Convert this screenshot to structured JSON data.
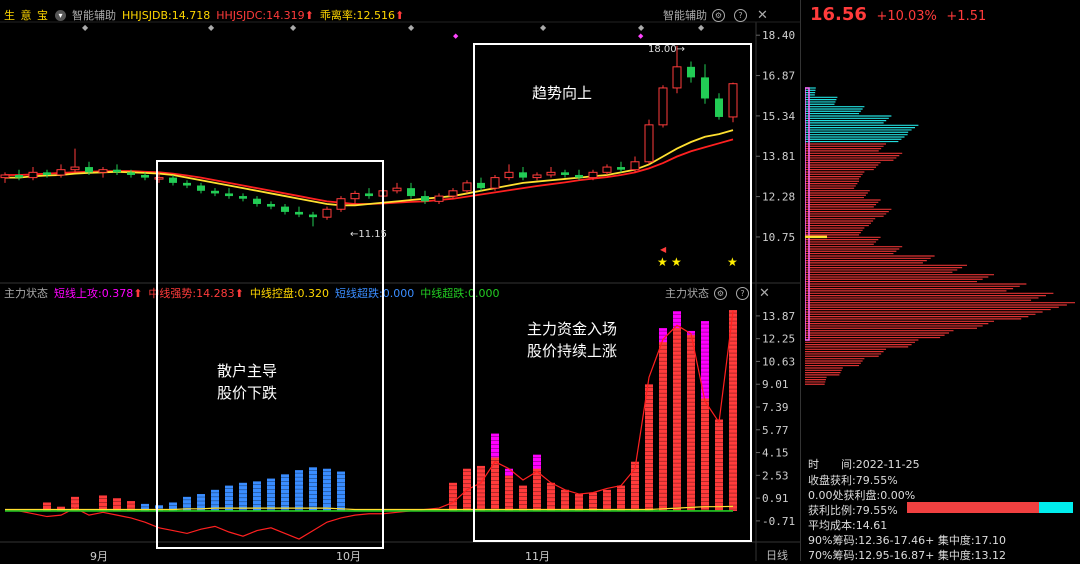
{
  "header": {
    "app": "生 意 宝",
    "indicator_name": "智能辅助",
    "items": [
      {
        "label": "HHJSJDB:14.718",
        "color": "#ffd700"
      },
      {
        "label": "HHJSJDC:14.319",
        "color": "#ff3b3b"
      },
      {
        "label": "乖离率:12.516",
        "color": "#ffd700"
      }
    ],
    "right_label": "智能辅助"
  },
  "sub_header": {
    "name": "主力状态",
    "items": [
      {
        "label": "短线上攻:0.378",
        "color": "#ff00ff"
      },
      {
        "label": "中线强势:14.283",
        "color": "#ff3b3b"
      },
      {
        "label": "中线控盘:0.320",
        "color": "#ffd700"
      },
      {
        "label": "短线超跌:0.000",
        "color": "#3a8dff"
      },
      {
        "label": "中线超跌:0.000",
        "color": "#22cc22"
      }
    ],
    "right_label": "主力状态"
  },
  "quote": {
    "price": "16.56",
    "pct": "+10.03%",
    "change": "+1.51"
  },
  "annotations": {
    "box1_line1": "散户主导",
    "box1_line2": "股价下跌",
    "box2_line1": "趋势向上",
    "box3_line1": "主力资金入场",
    "box3_line2": "股价持续上涨"
  },
  "price_marks": {
    "high": "18.00",
    "low": "11.15"
  },
  "x_axis": {
    "labels": [
      "9月",
      "10月",
      "11月"
    ],
    "period": "日线"
  },
  "stats": {
    "date_label": "时　　间:2022-11-25",
    "profit_close": "收盘获利:79.55%",
    "profit_zero": "0.00处获利盘:0.00%",
    "profit_ratio": "获利比例:79.55%",
    "avg_cost": "平均成本:14.61",
    "chip90": "90%筹码:12.36-17.46+ 集中度:17.10",
    "chip70": "70%筹码:12.95-16.87+ 集中度:13.12",
    "profit_ratio_value": 0.7955
  },
  "chart_data": [
    {
      "type": "candlestick",
      "title": "",
      "y_ticks": [
        18.4,
        16.87,
        15.34,
        13.81,
        12.28,
        10.75
      ],
      "ylim": [
        9.8,
        18.9
      ],
      "candles": [
        [
          13.0,
          13.2,
          12.8,
          13.1
        ],
        [
          13.1,
          13.3,
          12.9,
          13.0
        ],
        [
          13.0,
          13.4,
          12.9,
          13.2
        ],
        [
          13.2,
          13.3,
          13.0,
          13.1
        ],
        [
          13.1,
          13.5,
          13.0,
          13.3
        ],
        [
          13.3,
          14.1,
          13.2,
          13.4
        ],
        [
          13.4,
          13.6,
          13.1,
          13.2
        ],
        [
          13.2,
          13.4,
          13.0,
          13.3
        ],
        [
          13.3,
          13.5,
          13.1,
          13.2
        ],
        [
          13.2,
          13.3,
          13.0,
          13.1
        ],
        [
          13.1,
          13.2,
          12.9,
          13.0
        ],
        [
          13.0,
          13.2,
          12.8,
          13.0
        ],
        [
          13.0,
          13.1,
          12.7,
          12.8
        ],
        [
          12.8,
          12.9,
          12.6,
          12.7
        ],
        [
          12.7,
          12.8,
          12.4,
          12.5
        ],
        [
          12.5,
          12.6,
          12.3,
          12.4
        ],
        [
          12.4,
          12.6,
          12.2,
          12.3
        ],
        [
          12.3,
          12.4,
          12.1,
          12.2
        ],
        [
          12.2,
          12.3,
          11.9,
          12.0
        ],
        [
          12.0,
          12.1,
          11.8,
          11.9
        ],
        [
          11.9,
          12.0,
          11.6,
          11.7
        ],
        [
          11.7,
          11.9,
          11.5,
          11.6
        ],
        [
          11.6,
          11.7,
          11.15,
          11.5
        ],
        [
          11.5,
          11.9,
          11.4,
          11.8
        ],
        [
          11.8,
          12.3,
          11.7,
          12.2
        ],
        [
          12.2,
          12.5,
          12.0,
          12.4
        ],
        [
          12.4,
          12.6,
          12.2,
          12.3
        ],
        [
          12.3,
          12.6,
          12.1,
          12.5
        ],
        [
          12.5,
          12.8,
          12.4,
          12.6
        ],
        [
          12.6,
          12.8,
          12.2,
          12.3
        ],
        [
          12.3,
          12.5,
          12.0,
          12.1
        ],
        [
          12.1,
          12.4,
          12.0,
          12.3
        ],
        [
          12.3,
          12.6,
          12.2,
          12.5
        ],
        [
          12.5,
          12.9,
          12.4,
          12.8
        ],
        [
          12.8,
          13.0,
          12.5,
          12.6
        ],
        [
          12.6,
          13.1,
          12.5,
          13.0
        ],
        [
          13.0,
          13.5,
          12.9,
          13.2
        ],
        [
          13.2,
          13.4,
          12.9,
          13.0
        ],
        [
          13.0,
          13.2,
          12.9,
          13.1
        ],
        [
          13.1,
          13.4,
          13.0,
          13.2
        ],
        [
          13.2,
          13.3,
          13.0,
          13.1
        ],
        [
          13.1,
          13.3,
          12.9,
          13.0
        ],
        [
          13.0,
          13.3,
          12.9,
          13.2
        ],
        [
          13.2,
          13.5,
          13.1,
          13.4
        ],
        [
          13.4,
          13.6,
          13.2,
          13.3
        ],
        [
          13.3,
          13.8,
          13.2,
          13.6
        ],
        [
          13.6,
          15.2,
          13.5,
          15.0
        ],
        [
          15.0,
          16.5,
          14.9,
          16.4
        ],
        [
          16.4,
          18.0,
          16.2,
          17.2
        ],
        [
          17.2,
          17.4,
          16.6,
          16.8
        ],
        [
          16.8,
          17.3,
          15.8,
          16.0
        ],
        [
          16.0,
          16.2,
          15.2,
          15.3
        ],
        [
          15.3,
          16.6,
          15.1,
          16.56
        ]
      ],
      "ma_yellow": [
        13.0,
        13.0,
        13.05,
        13.08,
        13.1,
        13.15,
        13.18,
        13.2,
        13.22,
        13.2,
        13.18,
        13.15,
        13.1,
        13.0,
        12.9,
        12.8,
        12.7,
        12.6,
        12.5,
        12.4,
        12.3,
        12.2,
        12.1,
        12.0,
        11.95,
        11.95,
        12.0,
        12.05,
        12.1,
        12.15,
        12.2,
        12.25,
        12.3,
        12.4,
        12.5,
        12.6,
        12.7,
        12.8,
        12.85,
        12.9,
        12.95,
        13.0,
        13.05,
        13.1,
        13.2,
        13.3,
        13.5,
        13.8,
        14.1,
        14.35,
        14.55,
        14.65,
        14.8
      ],
      "ma_red": [
        13.1,
        13.1,
        13.12,
        13.15,
        13.18,
        13.2,
        13.22,
        13.24,
        13.25,
        13.25,
        13.22,
        13.2,
        13.15,
        13.08,
        13.0,
        12.9,
        12.8,
        12.7,
        12.6,
        12.5,
        12.4,
        12.3,
        12.2,
        12.1,
        12.05,
        12.0,
        12.0,
        12.02,
        12.05,
        12.08,
        12.1,
        12.15,
        12.2,
        12.28,
        12.36,
        12.44,
        12.52,
        12.6,
        12.68,
        12.75,
        12.82,
        12.9,
        12.96,
        13.02,
        13.1,
        13.2,
        13.35,
        13.55,
        13.8,
        14.0,
        14.15,
        14.3,
        14.45
      ],
      "stars": [
        47,
        48,
        52
      ]
    },
    {
      "type": "bar",
      "title": "",
      "y_ticks": [
        13.87,
        12.25,
        10.63,
        9.01,
        7.39,
        5.77,
        4.15,
        2.53,
        0.91,
        -0.71
      ],
      "ylim": [
        -1.5,
        15.0
      ],
      "series": [
        {
          "name": "短线上攻",
          "color": "#ff00ff",
          "values": [
            0,
            0,
            0,
            0,
            0,
            0,
            0,
            0,
            0,
            0,
            0,
            0,
            0,
            0,
            0,
            0,
            0,
            0,
            0,
            0,
            0,
            0,
            0,
            0,
            0,
            0,
            0,
            0,
            0,
            0,
            0,
            0,
            0,
            0,
            0,
            5.5,
            3.0,
            0,
            4.0,
            0,
            0,
            0,
            0,
            0,
            0,
            0,
            7.0,
            13.0,
            14.2,
            12.8,
            13.5,
            0.4,
            0.38
          ]
        },
        {
          "name": "中线强势",
          "color": "#ff3b3b",
          "values": [
            0,
            0,
            0,
            0.6,
            0.3,
            1.0,
            0,
            1.1,
            0.9,
            0.7,
            0,
            0,
            0,
            0,
            0,
            0,
            0,
            0,
            0,
            0,
            0,
            0,
            0,
            0,
            0,
            0,
            0,
            0,
            0,
            0,
            0,
            0,
            2.0,
            3.0,
            3.2,
            3.8,
            2.5,
            1.8,
            3.0,
            2.0,
            1.5,
            1.2,
            1.3,
            1.5,
            1.8,
            3.5,
            9.0,
            12.0,
            13.0,
            12.5,
            8.0,
            6.5,
            14.283
          ]
        },
        {
          "name": "短线超跌",
          "color": "#3a8dff",
          "values": [
            0,
            0,
            0,
            0,
            0,
            0,
            0,
            0,
            0,
            0,
            0.5,
            0.4,
            0.6,
            1.0,
            1.2,
            1.5,
            1.8,
            2.0,
            2.1,
            2.3,
            2.6,
            2.9,
            3.1,
            3.0,
            2.8,
            0,
            0,
            0,
            0,
            0,
            0,
            0,
            0,
            0,
            0,
            0,
            0,
            0,
            0,
            0,
            0,
            0,
            0,
            0,
            0,
            0,
            0,
            0,
            0,
            0,
            0,
            0,
            0
          ]
        }
      ],
      "line_red": [
        0,
        0,
        -0.2,
        -0.4,
        -0.3,
        0.2,
        -0.3,
        -0.1,
        -0.3,
        -0.5,
        -0.8,
        -1.2,
        -1.4,
        -1.6,
        -1.3,
        -1.1,
        -1.5,
        -1.8,
        -1.4,
        -1.2,
        -1.6,
        -2.0,
        -1.4,
        -0.8,
        -0.5,
        -0.3,
        -0.2,
        -0.2,
        -0.1,
        0,
        0.1,
        0.2,
        0.6,
        1.5,
        2.0,
        3.5,
        3.0,
        2.2,
        2.8,
        2.0,
        1.5,
        1.2,
        1.3,
        1.6,
        1.8,
        3.0,
        9.5,
        12.2,
        13.2,
        12.6,
        7.8,
        6.3,
        14.2
      ],
      "line_yellow": [
        0.1,
        0.1,
        0.1,
        0.1,
        0.1,
        0.1,
        0.1,
        0.1,
        0.1,
        0.1,
        0.1,
        0.1,
        0.1,
        0.15,
        0.15,
        0.2,
        0.2,
        0.2,
        0.2,
        0.2,
        0.2,
        0.2,
        0.2,
        0.2,
        0.15,
        0.1,
        0.1,
        0.1,
        0.1,
        0.1,
        0.1,
        0.1,
        0.1,
        0.1,
        0.1,
        0.1,
        0.1,
        0.1,
        0.1,
        0.1,
        0.1,
        0.1,
        0.1,
        0.1,
        0.1,
        0.1,
        0.1,
        0.15,
        0.2,
        0.25,
        0.3,
        0.3,
        0.32
      ],
      "line_green": [
        0,
        0,
        0,
        0,
        0,
        0,
        0,
        0,
        0,
        0,
        0,
        0,
        0,
        0,
        0,
        0,
        0,
        0,
        0,
        0,
        0,
        0,
        0,
        0,
        0,
        0,
        0,
        0,
        0,
        0,
        0,
        0,
        0,
        0,
        0,
        0,
        0,
        0,
        0,
        0,
        0,
        0,
        0,
        0,
        0,
        0,
        0,
        0,
        0,
        0,
        0,
        0,
        0
      ]
    },
    {
      "type": "bar",
      "title": "",
      "orientation": "horizontal",
      "ylim": [
        10.0,
        19.0
      ],
      "rows": [
        {
          "y": 17.8,
          "v": 0.04,
          "c": "#2dd"
        },
        {
          "y": 17.6,
          "v": 0.12,
          "c": "#2dd"
        },
        {
          "y": 17.4,
          "v": 0.22,
          "c": "#2dd"
        },
        {
          "y": 17.2,
          "v": 0.32,
          "c": "#2dd"
        },
        {
          "y": 17.0,
          "v": 0.42,
          "c": "#2dd"
        },
        {
          "y": 16.8,
          "v": 0.38,
          "c": "#2dd"
        },
        {
          "y": 16.6,
          "v": 0.3,
          "c": "#d33"
        },
        {
          "y": 16.4,
          "v": 0.36,
          "c": "#d33"
        },
        {
          "y": 16.2,
          "v": 0.28,
          "c": "#d33"
        },
        {
          "y": 16.0,
          "v": 0.22,
          "c": "#d33"
        },
        {
          "y": 15.8,
          "v": 0.2,
          "c": "#d33"
        },
        {
          "y": 15.6,
          "v": 0.24,
          "c": "#d33"
        },
        {
          "y": 15.4,
          "v": 0.28,
          "c": "#d33"
        },
        {
          "y": 15.2,
          "v": 0.32,
          "c": "#d33"
        },
        {
          "y": 15.0,
          "v": 0.26,
          "c": "#d33"
        },
        {
          "y": 14.8,
          "v": 0.22,
          "c": "#d33"
        },
        {
          "y": 14.6,
          "v": 0.28,
          "c": "#d33"
        },
        {
          "y": 14.4,
          "v": 0.36,
          "c": "#d33"
        },
        {
          "y": 14.2,
          "v": 0.48,
          "c": "#d33"
        },
        {
          "y": 14.0,
          "v": 0.6,
          "c": "#d33"
        },
        {
          "y": 13.8,
          "v": 0.7,
          "c": "#d33"
        },
        {
          "y": 13.6,
          "v": 0.82,
          "c": "#d33"
        },
        {
          "y": 13.4,
          "v": 0.92,
          "c": "#d33"
        },
        {
          "y": 13.2,
          "v": 1.0,
          "c": "#d33"
        },
        {
          "y": 13.0,
          "v": 0.88,
          "c": "#d33"
        },
        {
          "y": 12.8,
          "v": 0.7,
          "c": "#d33"
        },
        {
          "y": 12.6,
          "v": 0.55,
          "c": "#d33"
        },
        {
          "y": 12.4,
          "v": 0.42,
          "c": "#d33"
        },
        {
          "y": 12.2,
          "v": 0.3,
          "c": "#d33"
        },
        {
          "y": 12.0,
          "v": 0.22,
          "c": "#d33"
        },
        {
          "y": 11.8,
          "v": 0.14,
          "c": "#d33"
        },
        {
          "y": 11.6,
          "v": 0.08,
          "c": "#d33"
        }
      ],
      "avg_cost": 14.61
    }
  ]
}
